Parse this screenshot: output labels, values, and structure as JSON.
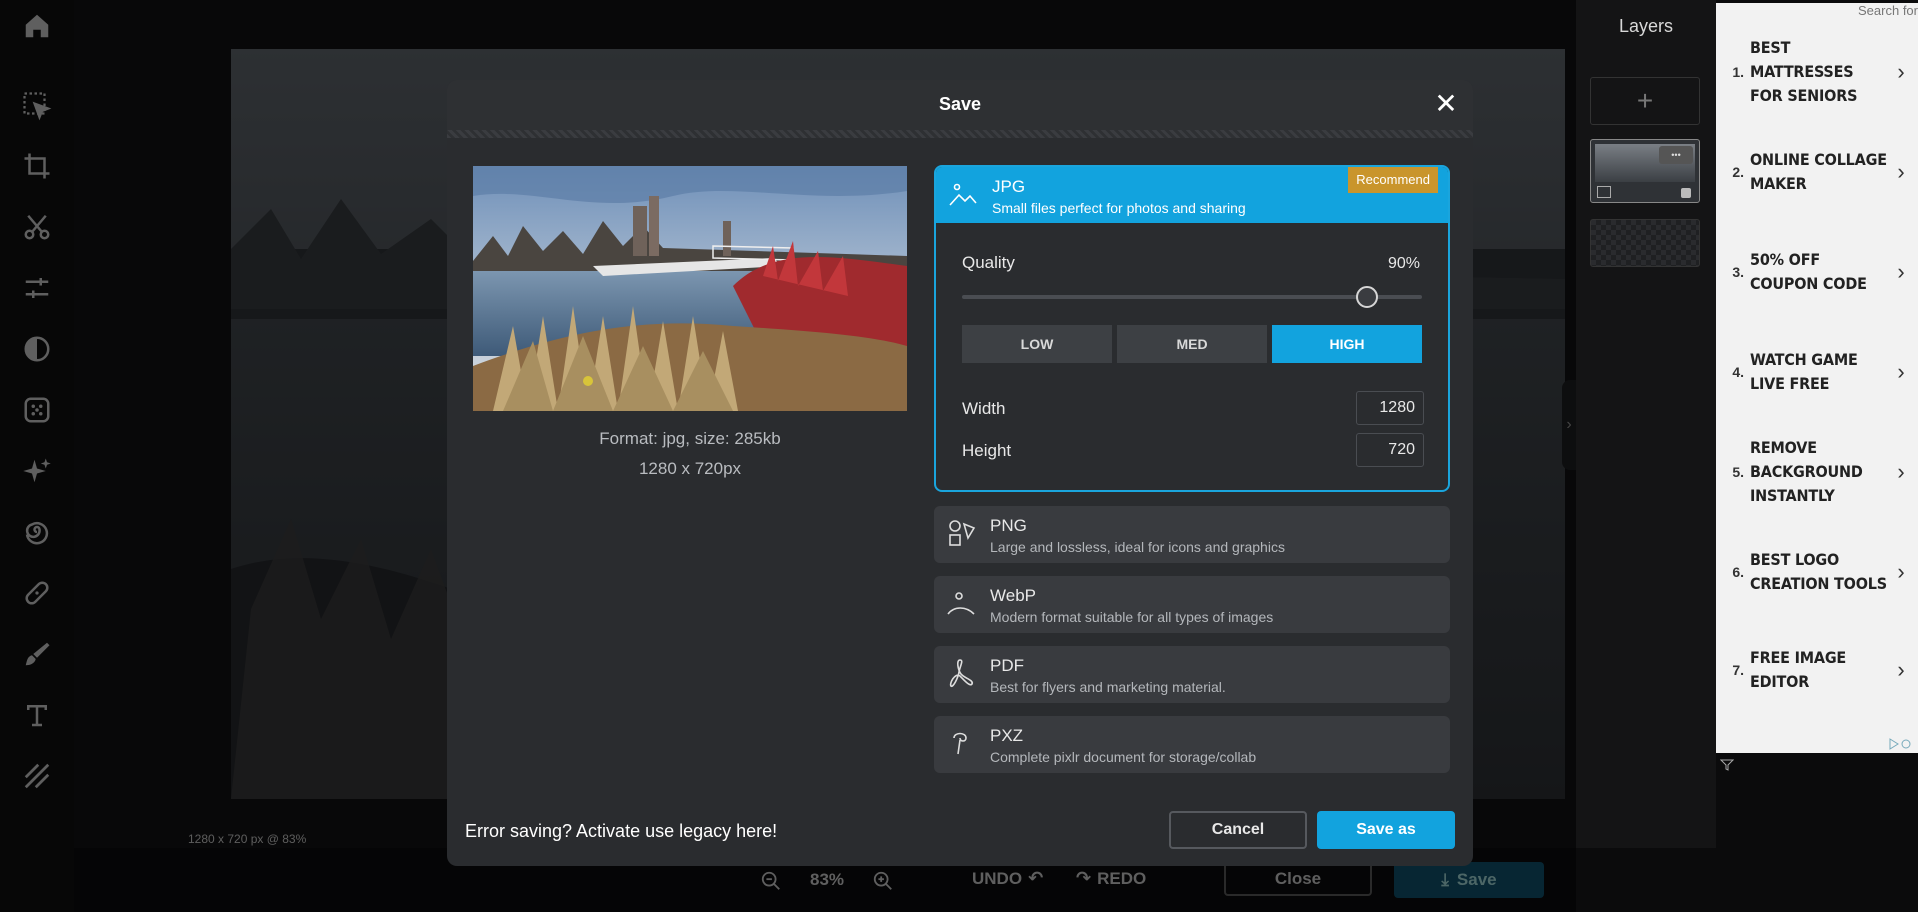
{
  "workspace": {
    "status_text": "1280 x 720 px @ 83%"
  },
  "bottombar": {
    "zoom": "83%",
    "undo_label": "UNDO",
    "redo_label": "REDO",
    "close_label": "Close",
    "save_label": "Save"
  },
  "layers": {
    "title": "Layers",
    "add_glyph": "+",
    "more_glyph": "•••"
  },
  "ad": {
    "search": "Search for",
    "items": [
      {
        "num": "1.",
        "label": "BEST MATTRESSES FOR SENIORS"
      },
      {
        "num": "2.",
        "label": "ONLINE COLLAGE MAKER"
      },
      {
        "num": "3.",
        "label": "50% OFF COUPON CODE"
      },
      {
        "num": "4.",
        "label": "WATCH GAME LIVE FREE"
      },
      {
        "num": "5.",
        "label": "REMOVE BACKGROUND INSTANTLY"
      },
      {
        "num": "6.",
        "label": "BEST LOGO CREATION TOOLS"
      },
      {
        "num": "7.",
        "label": "FREE IMAGE EDITOR"
      }
    ]
  },
  "modal": {
    "title": "Save",
    "close_glyph": "✕",
    "format_info": "Format: jpg, size: 285kb",
    "dimensions": "1280 x 720px",
    "jpg": {
      "name": "JPG",
      "desc": "Small files perfect for photos and sharing",
      "badge": "Recommend",
      "quality_label": "Quality",
      "quality_value": "90%",
      "quality_fraction": 0.88,
      "low": "LOW",
      "med": "MED",
      "high": "HIGH",
      "width_label": "Width",
      "width_value": "1280",
      "height_label": "Height",
      "height_value": "720"
    },
    "formats": [
      {
        "name": "PNG",
        "desc": "Large and lossless, ideal for icons and graphics"
      },
      {
        "name": "WebP",
        "desc": "Modern format suitable for all types of images"
      },
      {
        "name": "PDF",
        "desc": "Best for flyers and marketing material."
      },
      {
        "name": "PXZ",
        "desc": "Complete pixlr document for storage/collab"
      }
    ],
    "legacy": "Error saving? Activate use legacy here!",
    "cancel": "Cancel",
    "save_as": "Save as"
  },
  "colors": {
    "accent": "#12a3de",
    "badge": "#c9952c"
  }
}
